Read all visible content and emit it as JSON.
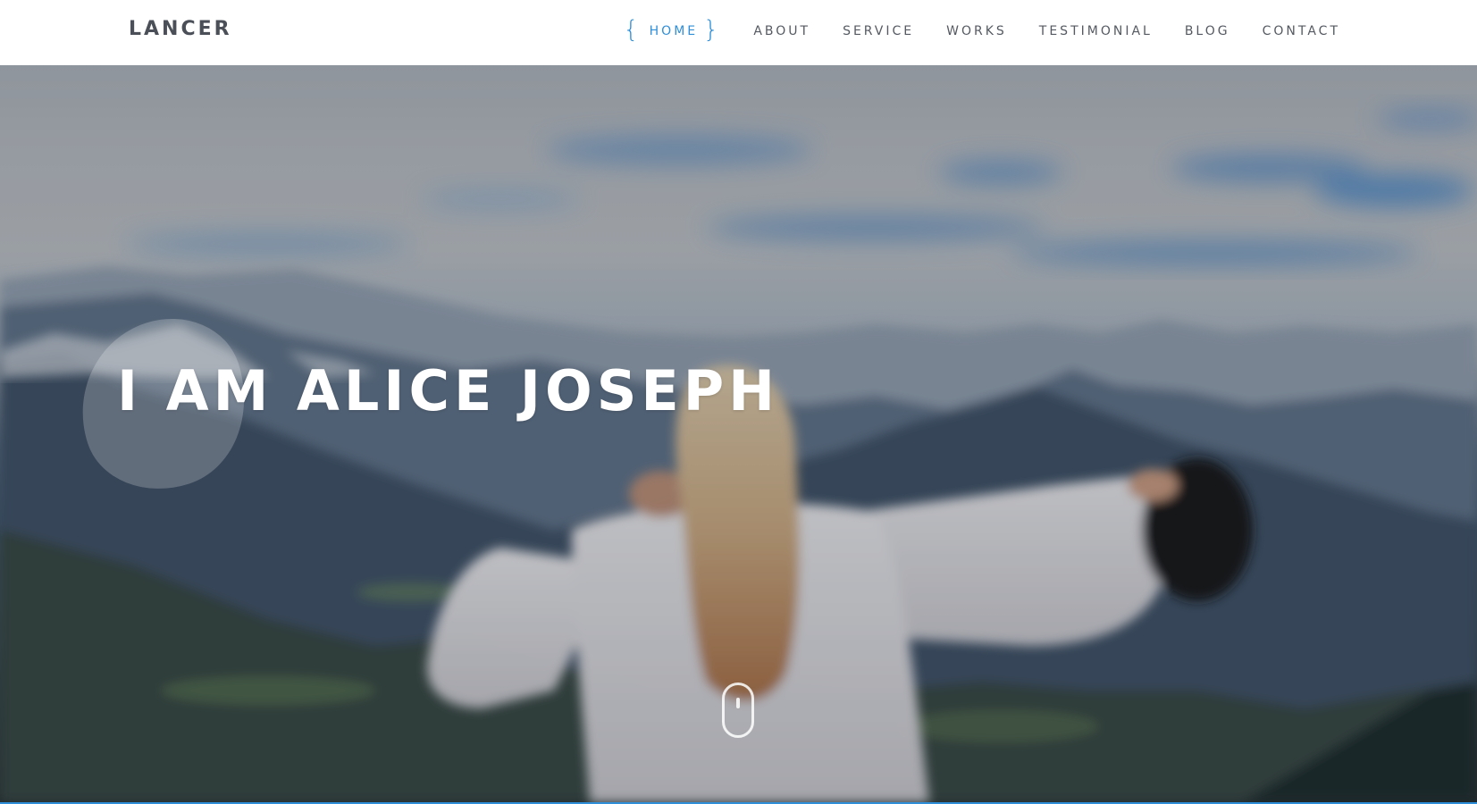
{
  "header": {
    "brand": "LANCER",
    "nav": [
      {
        "label": "HOME",
        "active": true
      },
      {
        "label": "ABOUT",
        "active": false
      },
      {
        "label": "SERVICE",
        "active": false
      },
      {
        "label": "WORKS",
        "active": false
      },
      {
        "label": "TESTIMONIAL",
        "active": false
      },
      {
        "label": "BLOG",
        "active": false
      },
      {
        "label": "CONTACT",
        "active": false
      }
    ],
    "active_brace_left": "{",
    "active_brace_right": "}"
  },
  "hero": {
    "title": "I AM ALICE JOSEPH",
    "background_description_icon": "mountain-woman-photo",
    "scroll_indicator_icon": "mouse-scroll-icon"
  },
  "colors": {
    "accent": "#2f8fd8",
    "brand_text": "#4a4f58",
    "nav_text": "#555a62",
    "hero_title": "#ffffff"
  }
}
